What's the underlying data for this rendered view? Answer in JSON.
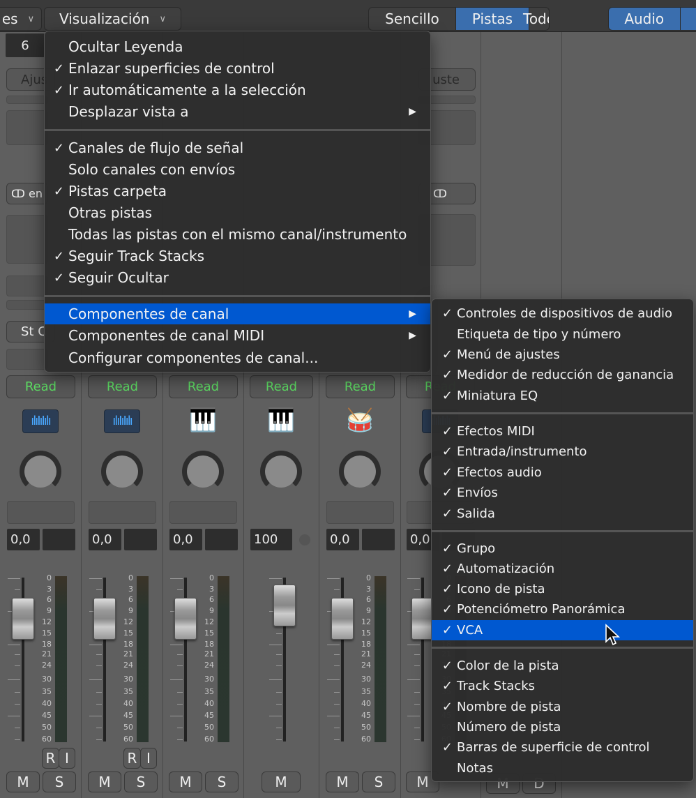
{
  "toolbar": {
    "left_menu": "es",
    "view_menu": "Visualización",
    "segments": [
      "Sencillo",
      "Pistas",
      "Todo"
    ],
    "active_segment": "Pistas",
    "filter_active": "Audio",
    "accent": "#3a6eae"
  },
  "left_panel": {
    "number": "6",
    "settings_left": "Ajus",
    "settings_right": "uste",
    "link_text": "en",
    "stereo_text": "St C"
  },
  "view_menu": {
    "groups": [
      [
        {
          "label": "Ocultar Leyenda",
          "checked": false
        },
        {
          "label": "Enlazar superficies de control",
          "checked": true
        },
        {
          "label": "Ir automáticamente a la selección",
          "checked": true
        },
        {
          "label": "Desplazar vista a",
          "checked": false,
          "submenu": true
        }
      ],
      [
        {
          "label": "Canales de flujo de señal",
          "checked": true
        },
        {
          "label": "Solo canales con envíos",
          "checked": false
        },
        {
          "label": "Pistas carpeta",
          "checked": true
        },
        {
          "label": "Otras pistas",
          "checked": false
        },
        {
          "label": "Todas las pistas con el mismo canal/instrumento",
          "checked": false
        },
        {
          "label": "Seguir Track Stacks",
          "checked": true
        },
        {
          "label": "Seguir Ocultar",
          "checked": true
        }
      ],
      [
        {
          "label": "Componentes de canal",
          "checked": false,
          "submenu": true,
          "highlighted": true
        },
        {
          "label": "Componentes de canal MIDI",
          "checked": false,
          "submenu": true
        },
        {
          "label": "Configurar componentes de canal...",
          "checked": false
        }
      ]
    ]
  },
  "submenu": {
    "groups": [
      [
        {
          "label": "Controles de dispositivos de audio",
          "checked": true
        },
        {
          "label": "Etiqueta de tipo y número",
          "checked": false
        },
        {
          "label": "Menú de ajustes",
          "checked": true
        },
        {
          "label": "Medidor de reducción de ganancia",
          "checked": true
        },
        {
          "label": "Miniatura EQ",
          "checked": true
        }
      ],
      [
        {
          "label": "Efectos MIDI",
          "checked": true
        },
        {
          "label": "Entrada/instrumento",
          "checked": true
        },
        {
          "label": "Efectos audio",
          "checked": true
        },
        {
          "label": "Envíos",
          "checked": true
        },
        {
          "label": "Salida",
          "checked": true
        }
      ],
      [
        {
          "label": "Grupo",
          "checked": true
        },
        {
          "label": "Automatización",
          "checked": true
        },
        {
          "label": "Icono de pista",
          "checked": true
        },
        {
          "label": "Potenciómetro Panorámica",
          "checked": true
        },
        {
          "label": "VCA",
          "checked": true,
          "highlighted": true
        }
      ],
      [
        {
          "label": "Color de la pista",
          "checked": true
        },
        {
          "label": "Track Stacks",
          "checked": true
        },
        {
          "label": "Nombre de pista",
          "checked": true
        },
        {
          "label": "Número de pista",
          "checked": false
        },
        {
          "label": "Barras de superficie de control",
          "checked": true
        },
        {
          "label": "Notas",
          "checked": false
        }
      ]
    ]
  },
  "check_glyph": "✓",
  "arrow_glyph": "▶",
  "meter_scale": [
    "0",
    "3",
    "6",
    "9",
    "12",
    "15",
    "18",
    "21",
    "24",
    "30",
    "35",
    "40",
    "45",
    "50",
    "60"
  ],
  "strips": [
    {
      "automation": "Read",
      "icon": "audio-waveform-icon",
      "value": "0,0",
      "ri": [
        "R",
        "I"
      ],
      "buttons": [
        "M",
        "S"
      ]
    },
    {
      "automation": "Read",
      "icon": "audio-waveform-icon",
      "value": "0,0",
      "ri": [
        "R",
        "I"
      ],
      "buttons": [
        "M",
        "S"
      ]
    },
    {
      "automation": "Read",
      "icon": "synthesizer-icon",
      "value": "0,0",
      "buttons": [
        "M",
        "S"
      ]
    },
    {
      "automation": "Read",
      "icon": "grand-piano-icon",
      "value": "100",
      "midi": true,
      "buttons": [
        "M"
      ]
    },
    {
      "automation": "Read",
      "icon": "drum-kit-icon",
      "value": "0,0",
      "buttons": [
        "M",
        "S"
      ]
    },
    {
      "automation": "Read",
      "icon": "audio-waveform-icon",
      "value": "0,0",
      "buttons": [
        "M"
      ]
    }
  ],
  "hidden_buttons": [
    "M",
    "D"
  ],
  "automation_color": "#5ddc63",
  "highlight_color": "#0058d0"
}
